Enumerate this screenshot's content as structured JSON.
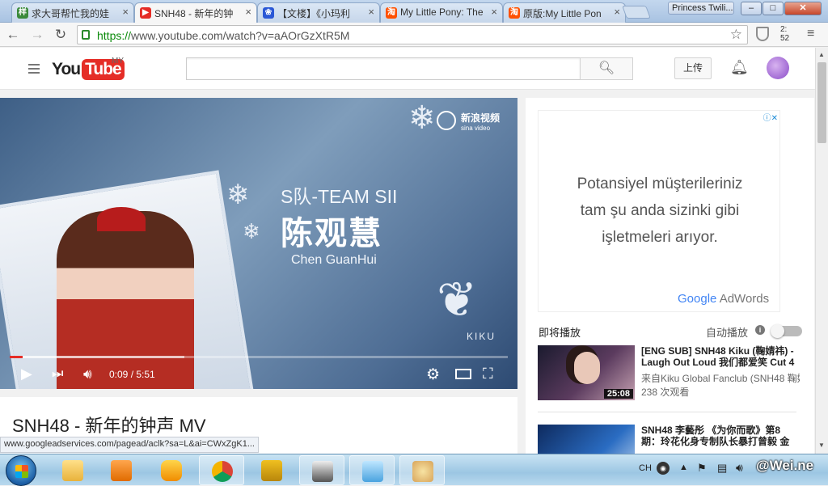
{
  "browser": {
    "tabs": [
      {
        "title": "求大哥帮忙我的娃",
        "favicon": "tieba"
      },
      {
        "title": "SNH48 - 新年的钟",
        "favicon": "youtube",
        "active": true
      },
      {
        "title": "【文楼】《小玛利",
        "favicon": "baidu"
      },
      {
        "title": "My Little Pony: The",
        "favicon": "taobao"
      },
      {
        "title": "原版:My Little Pon",
        "favicon": "taobao"
      }
    ],
    "profile_name": "Princess Twili...",
    "minimize": "–",
    "maximize": "□",
    "close": "✕",
    "url_scheme": "https://",
    "url_rest": "www.youtube.com/watch?v=aAOrGzXtR5M",
    "ext_clock": "2:\n52"
  },
  "youtube": {
    "logo_you": "You",
    "logo_tube": "Tube",
    "region": "MY",
    "search_placeholder": "",
    "upload_label": "上传"
  },
  "player": {
    "overlay_team": "S队-TEAM SII",
    "overlay_name_cn": "陈观慧",
    "overlay_name_en": "Chen GuanHui",
    "watermark_cn": "新浪视频",
    "watermark_en": "sina video",
    "kiku_mark": "KIKU",
    "current_time": "0:09",
    "duration": "5:51",
    "time_text": "0:09 / 5:51",
    "progress_fraction": 0.026,
    "buffer_fraction": 0.35
  },
  "video": {
    "title": "SNH48 - 新年的钟声 MV"
  },
  "sidebar": {
    "ad": {
      "line1": "Potansiyel müşterileriniz",
      "line2": "tam şu anda sizinki gibi",
      "line3": "işletmeleri arıyor.",
      "adchoices": "ⓘ✕",
      "brand_google": "Google",
      "brand_adwords": " AdWords"
    },
    "up_next": "即将播放",
    "autoplay": "自动播放",
    "recommendations": [
      {
        "title": "[ENG SUB] SNH48 Kiku (鞠婧祎) - Laugh Out Loud 我们都爱笑 Cut 4",
        "channel": "来自Kiku Global Fanclub (SNH48 鞠婧",
        "views": "238 次观看",
        "duration": "25:08"
      },
      {
        "title": "SNH48 李藝彤 《为你而歌》第8期：玲花化身专制队长暴打曾毅 金",
        "channel": "",
        "views": "",
        "duration": ""
      }
    ]
  },
  "status_bar": "www.googleadservices.com/pagead/aclk?sa=L&ai=CWxZgK1...",
  "taskbar": {
    "lang": "CH",
    "watermark": "@Wei.ne"
  }
}
